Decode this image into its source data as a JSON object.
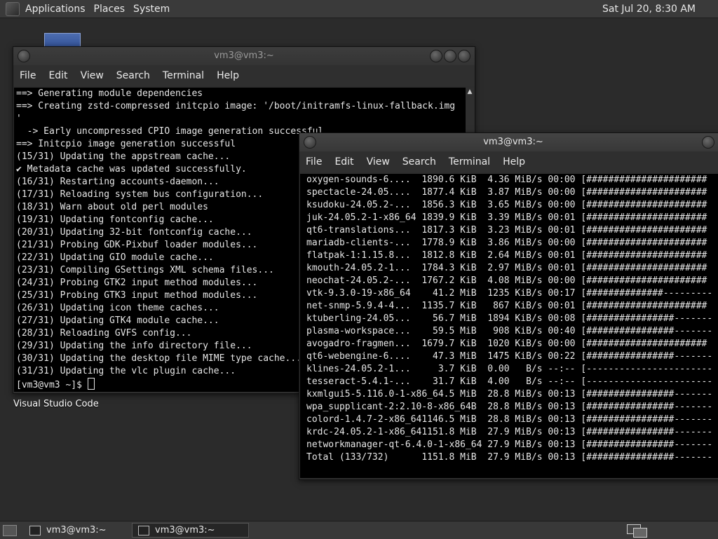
{
  "top_panel": {
    "menu": [
      "Applications",
      "Places",
      "System"
    ],
    "clock": "Sat Jul 20,  8:30 AM"
  },
  "desktop": {
    "icon_label": "Visual Studio Code"
  },
  "window_back": {
    "title": "vm3@vm3:~",
    "menu": [
      "File",
      "Edit",
      "View",
      "Search",
      "Terminal",
      "Help"
    ],
    "lines": [
      "==> Generating module dependencies",
      "==> Creating zstd-compressed initcpio image: '/boot/initramfs-linux-fallback.img",
      "'",
      "  -> Early uncompressed CPIO image generation successful",
      "==> Initcpio image generation successful",
      "(15/31) Updating the appstream cache...",
      "✔ Metadata cache was updated successfully.",
      "(16/31) Restarting accounts-daemon...",
      "(17/31) Reloading system bus configuration...",
      "(18/31) Warn about old perl modules",
      "(19/31) Updating fontconfig cache...",
      "(20/31) Updating 32-bit fontconfig cache...",
      "(21/31) Probing GDK-Pixbuf loader modules...",
      "(22/31) Updating GIO module cache...",
      "(23/31) Compiling GSettings XML schema files...",
      "(24/31) Probing GTK2 input method modules...",
      "(25/31) Probing GTK3 input method modules...",
      "(26/31) Updating icon theme caches...",
      "(27/31) Updating GTK4 module cache...",
      "(28/31) Reloading GVFS config...",
      "(29/31) Updating the info directory file...",
      "(30/31) Updating the desktop file MIME type cache...",
      "(31/31) Updating the vlc plugin cache..."
    ],
    "prompt": "[vm3@vm3 ~]$ "
  },
  "window_front": {
    "title": "vm3@vm3:~",
    "menu": [
      "File",
      "Edit",
      "View",
      "Search",
      "Terminal",
      "Help"
    ],
    "lines": [
      "oxygen-sounds-6....  1890.6 KiB  4.36 MiB/s 00:00 [######################",
      "spectacle-24.05....  1877.4 KiB  3.87 MiB/s 00:00 [######################",
      "ksudoku-24.05.2-...  1856.3 KiB  3.65 MiB/s 00:00 [######################",
      "juk-24.05.2-1-x86_64 1839.9 KiB  3.39 MiB/s 00:01 [######################",
      "qt6-translations...  1817.3 KiB  3.23 MiB/s 00:01 [######################",
      "mariadb-clients-...  1778.9 KiB  3.86 MiB/s 00:00 [######################",
      "flatpak-1:1.15.8...  1812.8 KiB  2.64 MiB/s 00:01 [######################",
      "kmouth-24.05.2-1...  1784.3 KiB  2.97 MiB/s 00:01 [######################",
      "neochat-24.05.2-...  1767.2 KiB  4.08 MiB/s 00:00 [######################",
      "vtk-9.3.0-19-x86_64    41.2 MiB  1235 KiB/s 00:17 [##############---------",
      "net-snmp-5.9.4-4...  1135.7 KiB   867 KiB/s 00:01 [######################",
      "ktuberling-24.05...    56.7 MiB  1894 KiB/s 00:08 [################-------",
      "plasma-workspace...    59.5 MiB   908 KiB/s 00:40 [################-------",
      "avogadro-fragmen...  1679.7 KiB  1020 KiB/s 00:00 [######################",
      "qt6-webengine-6....    47.3 MiB  1475 KiB/s 00:22 [################-------",
      "klines-24.05.2-1...     3.7 KiB  0.00   B/s --:-- [-----------------------",
      "tesseract-5.4.1-...    31.7 KiB  4.00   B/s --:-- [-----------------------",
      "kxmlgui5-5.116.0-1-x86_64.5 MiB  28.8 MiB/s 00:13 [################-------",
      "wpa_supplicant-2:2.10-8-x86_64B  28.8 MiB/s 00:13 [################-------",
      "colord-1.4.7-2-x86_641146.5 MiB  28.8 MiB/s 00:13 [################-------",
      "krdc-24.05.2-1-x86_641151.8 MiB  27.9 MiB/s 00:13 [################-------",
      "networkmanager-qt-6.4.0-1-x86_64 27.9 MiB/s 00:13 [################-------",
      "Total (133/732)      1151.8 MiB  27.9 MiB/s 00:13 [################-------"
    ]
  },
  "bottom_panel": {
    "tasks": [
      "vm3@vm3:~",
      "vm3@vm3:~"
    ]
  }
}
